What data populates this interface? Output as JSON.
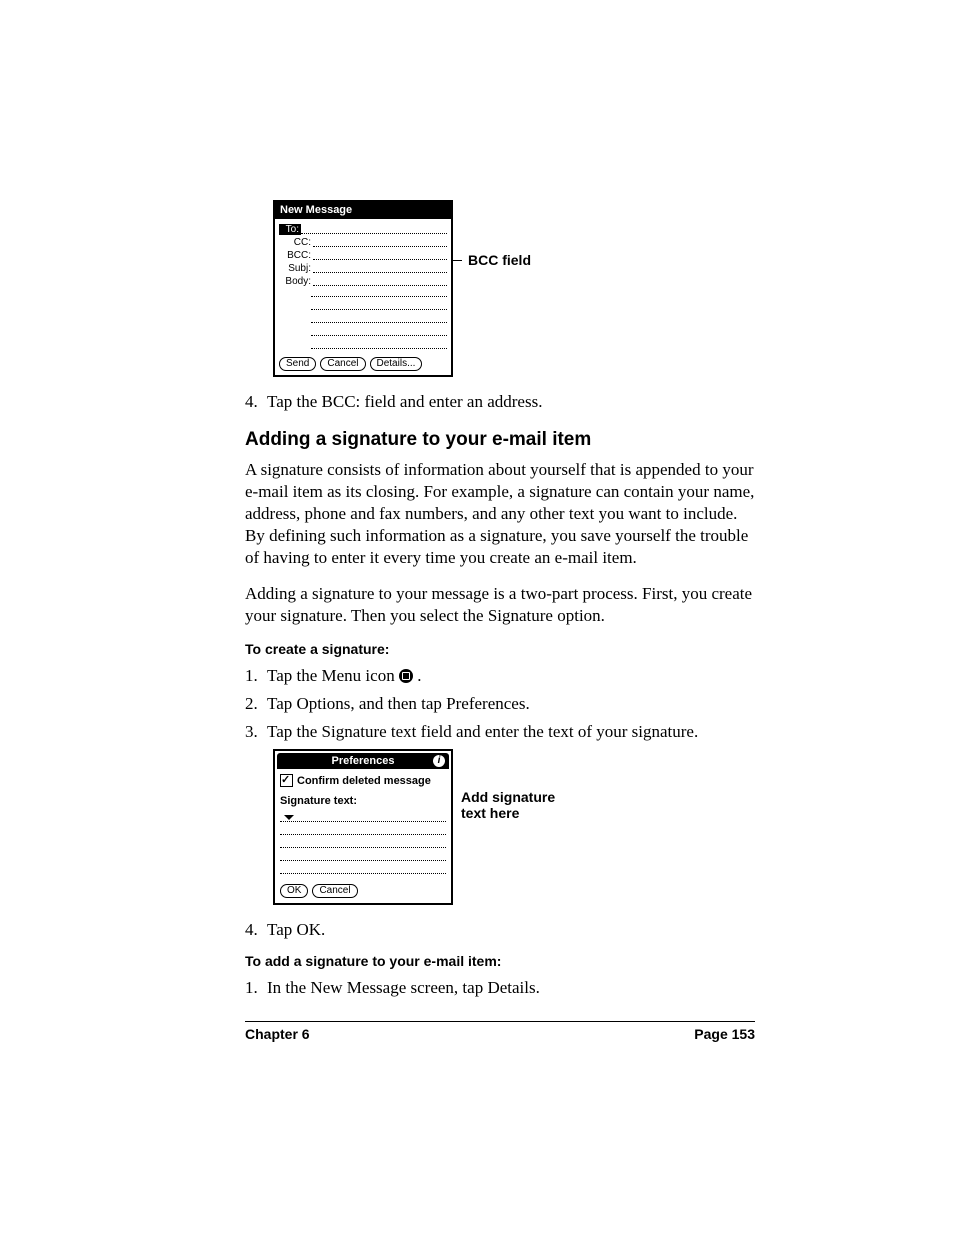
{
  "figure1": {
    "title": "New Message",
    "labels": {
      "to": "To:",
      "cc": "CC:",
      "bcc": "BCC:",
      "subj": "Subj:",
      "body": "Body:"
    },
    "buttons": {
      "send": "Send",
      "cancel": "Cancel",
      "details": "Details..."
    },
    "callout": "BCC field"
  },
  "step4": {
    "num": "4.",
    "text": "Tap the BCC: field and enter an address."
  },
  "section_heading": "Adding a signature to your e-mail item",
  "para1": "A signature consists of information about yourself that is appended to your e-mail item as its closing. For example, a signature can contain your name, address, phone and fax numbers, and any other text you want to include. By defining such information as a signature, you save yourself the trouble of having to enter it every time you create an e-mail item.",
  "para2": "Adding a signature to your message is a two-part process. First, you create your signature. Then you select the Signature option.",
  "subhead1": "To create a signature:",
  "steps_create": [
    {
      "num": "1.",
      "text_before": "Tap the Menu icon ",
      "text_after": " ."
    },
    {
      "num": "2.",
      "text": "Tap Options, and then tap Preferences."
    },
    {
      "num": "3.",
      "text": "Tap the Signature text field and enter the text of your signature."
    }
  ],
  "figure2": {
    "title": "Preferences",
    "info_glyph": "i",
    "checkbox_label": "Confirm deleted message",
    "sig_label": "Signature text:",
    "buttons": {
      "ok": "OK",
      "cancel": "Cancel"
    },
    "callout_line1": "Add signature",
    "callout_line2": "text here"
  },
  "step_create_4": {
    "num": "4.",
    "text": "Tap OK."
  },
  "subhead2": "To add a signature to your e-mail item:",
  "steps_add": [
    {
      "num": "1.",
      "text": "In the New Message screen, tap Details."
    }
  ],
  "footer": {
    "chapter": "Chapter 6",
    "page": "Page 153"
  }
}
